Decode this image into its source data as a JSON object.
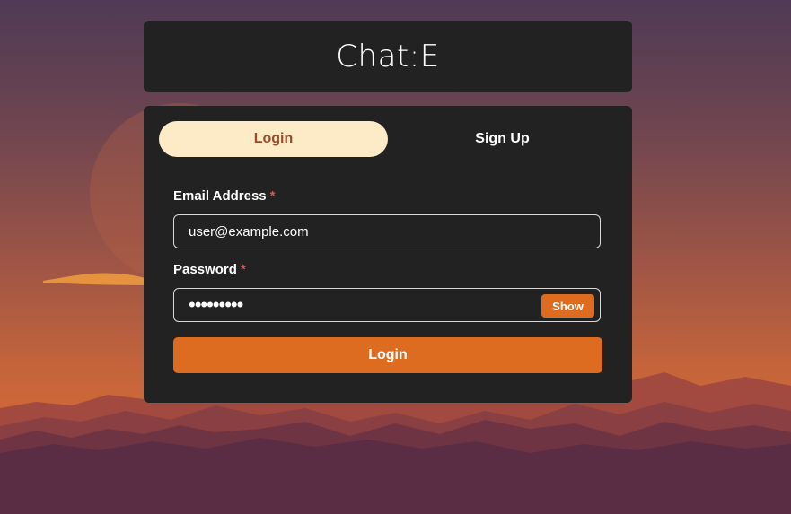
{
  "header": {
    "title": "Chat:E"
  },
  "tabs": [
    {
      "label": "Login",
      "active": true
    },
    {
      "label": "Sign Up",
      "active": false
    }
  ],
  "form": {
    "email": {
      "label": "Email Address",
      "required_mark": "*",
      "value": "user@example.com"
    },
    "password": {
      "label": "Password",
      "required_mark": "*",
      "value": "•••••••••",
      "toggle_label": "Show"
    },
    "submit_label": "Login"
  },
  "colors": {
    "card_bg": "#222222",
    "accent": "#dd6b20",
    "active_tab_bg": "#fdebc8",
    "active_tab_text": "#9c4a2c",
    "required": "#e5534b"
  },
  "icons": {
    "background": "mountain-sunset-wallpaper"
  }
}
